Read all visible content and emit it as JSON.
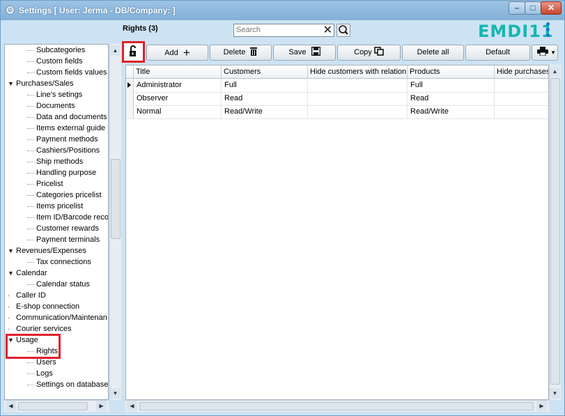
{
  "window": {
    "title": "Settings  [ User: Jerma - DB/Company:  ]",
    "minimize_glyph": "–",
    "maximize_glyph": "□",
    "close_glyph": "✕"
  },
  "tree": {
    "items": [
      {
        "label": "Subcategories",
        "level": 1
      },
      {
        "label": "Custom fields",
        "level": 1
      },
      {
        "label": "Custom fields values",
        "level": 1
      },
      {
        "label": "Purchases/Sales",
        "level": 0
      },
      {
        "label": "Line's setings",
        "level": 1
      },
      {
        "label": "Documents",
        "level": 1
      },
      {
        "label": "Data and documents c",
        "level": 1
      },
      {
        "label": "Items external guide",
        "level": 1
      },
      {
        "label": "Payment methods",
        "level": 1
      },
      {
        "label": "Cashiers/Positions",
        "level": 1
      },
      {
        "label": "Ship methods",
        "level": 1
      },
      {
        "label": "Handling purpose",
        "level": 1
      },
      {
        "label": "Pricelist",
        "level": 1
      },
      {
        "label": "Categories pricelist",
        "level": 1
      },
      {
        "label": "Items pricelist",
        "level": 1
      },
      {
        "label": "Item ID/Barcode recog",
        "level": 1
      },
      {
        "label": "Customer rewards",
        "level": 1
      },
      {
        "label": "Payment terminals",
        "level": 1
      },
      {
        "label": "Revenues/Expenses",
        "level": 0
      },
      {
        "label": "Tax connections",
        "level": 1
      },
      {
        "label": "Calendar",
        "level": 0
      },
      {
        "label": "Calendar status",
        "level": 1
      },
      {
        "label": "Caller ID",
        "level": 0
      },
      {
        "label": "E-shop connection",
        "level": 0
      },
      {
        "label": "Communication/Maintenan",
        "level": 0
      },
      {
        "label": "Courier services",
        "level": 0
      },
      {
        "label": "Usage",
        "level": 0
      },
      {
        "label": "Rights",
        "level": 1
      },
      {
        "label": "Users",
        "level": 1
      },
      {
        "label": "Logs",
        "level": 1
      },
      {
        "label": "Settings on database",
        "level": 1
      }
    ]
  },
  "panel": {
    "title": "Rights (3)",
    "search_placeholder": "Search",
    "logo_text": "EMDI11"
  },
  "toolbar": {
    "add_label": "Add",
    "delete_label": "Delete",
    "save_label": "Save",
    "copy_label": "Copy",
    "delete_all_label": "Delete all",
    "default_label": "Default"
  },
  "grid": {
    "columns": [
      "Title",
      "Customers",
      "Hide customers with relation",
      "Products",
      "Hide purchases"
    ],
    "rows": [
      [
        "Administrator",
        "Full",
        "",
        "Full",
        ""
      ],
      [
        "Observer",
        "Read",
        "",
        "Read",
        ""
      ],
      [
        "Normal",
        "Read/Write",
        "",
        "Read/Write",
        ""
      ]
    ]
  },
  "colors": {
    "highlight": "#e0202a",
    "logo": "#17b6b0",
    "window_bg": "#cde3f3"
  }
}
